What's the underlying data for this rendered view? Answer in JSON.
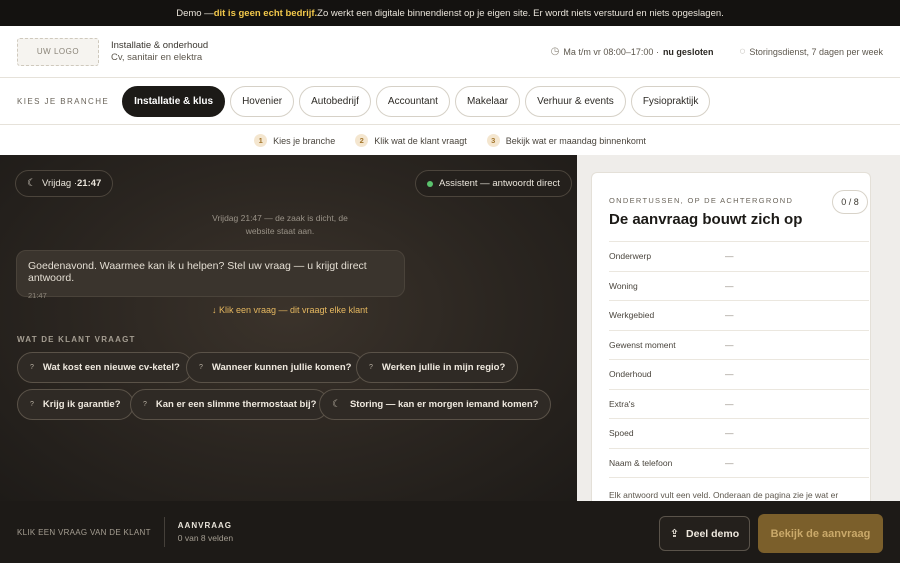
{
  "demo_bar": {
    "prefix": "Demo — ",
    "strong": "dit is geen echt bedrijf.",
    "suffix": " Zo werkt een digitale binnendienst op je eigen site. Er wordt niets verstuurd en niets opgeslagen."
  },
  "header": {
    "logo": "UW LOGO",
    "company_line1": "Installatie & onderhoud",
    "company_line2": "Cv, sanitair en elektra",
    "hours": "Ma t/m vr 08:00–17:00 ·",
    "hours_status": "nu gesloten",
    "service": "Storingsdienst, 7 dagen per week"
  },
  "branche": {
    "label": "KIES JE BRANCHE",
    "items": [
      "Installatie & klus",
      "Hovenier",
      "Autobedrijf",
      "Accountant",
      "Makelaar",
      "Verhuur & events",
      "Fysiopraktijk"
    ]
  },
  "steps": [
    {
      "num": "1",
      "label": "Kies je branche"
    },
    {
      "num": "2",
      "label": "Klik wat de klant vraagt"
    },
    {
      "num": "3",
      "label": "Bekijk wat er maandag binnenkomt"
    }
  ],
  "chat": {
    "time_chip_day": "Vrijdag · ",
    "time_chip_time": "21:47",
    "assistant_chip": "Assistent — antwoordt direct",
    "system_message": "Vrijdag 21:47 — de zaak is dicht, de website staat aan.",
    "greeting": "Goedenavond. Waarmee kan ik u helpen? Stel uw vraag — u krijgt direct antwoord.",
    "greeting_time": "21:47",
    "hint": "↓  Klik een vraag — dit vraagt elke klant",
    "questions_label": "WAT DE KLANT VRAAGT",
    "questions": [
      "Wat kost een nieuwe cv-ketel?",
      "Wanneer kunnen jullie komen?",
      "Werken jullie in mijn regio?",
      "Krijg ik garantie?",
      "Kan er een slimme thermostaat bij?",
      "Storing — kan er morgen iemand komen?"
    ]
  },
  "card": {
    "kicker": "ONDERTUSSEN, OP DE ACHTERGROND",
    "title": "De aanvraag bouwt zich op",
    "counter": "0 / 8",
    "empty_value": "—",
    "fields": [
      "Onderwerp",
      "Woning",
      "Werkgebied",
      "Gewenst moment",
      "Onderhoud",
      "Extra's",
      "Spoed",
      "Naam & telefoon"
    ],
    "footer": "Elk antwoord vult een veld. Onderaan de pagina zie je wat er"
  },
  "bottom": {
    "hint": "KLIK EEN VRAAG VAN DE KLANT",
    "aanvraag_title": "AANVRAAG",
    "aanvraag_sub": "0 van 8 velden",
    "share_label": "Deel demo",
    "view_label": "Bekijk de aanvraag"
  }
}
